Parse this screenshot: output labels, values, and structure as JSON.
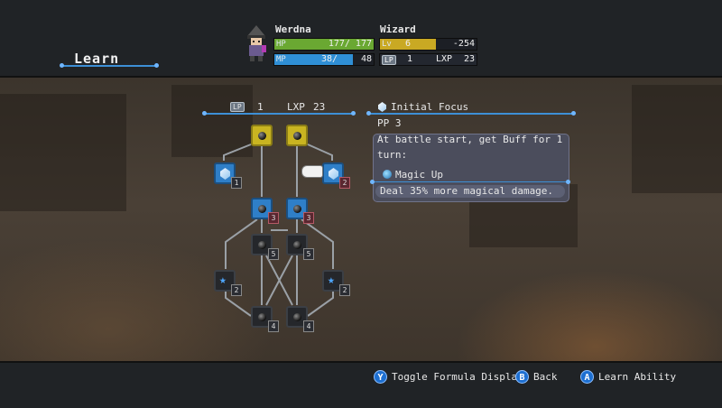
{
  "screen_title": "Learn",
  "character": {
    "name": "Werdna",
    "class": "Wizard",
    "hp": {
      "label": "HP",
      "current": "177",
      "max": "177",
      "text": "177/ 177",
      "fraction": 1.0
    },
    "mp": {
      "label": "MP",
      "current": "38",
      "max": "48",
      "text": "38/",
      "max_text": "48",
      "fraction": 0.79
    },
    "lv": {
      "label": "Lv",
      "value": "6",
      "exp_text": "-254",
      "fraction": 0.6
    },
    "lp_header": {
      "label": "LP",
      "value": "1",
      "lxp_label": "LXP",
      "lxp_value": "23"
    }
  },
  "tree_header": {
    "lp_label": "LP",
    "lp_value": "1",
    "lxp_label": "LXP",
    "lxp_value": "23"
  },
  "ability": {
    "name": "Initial Focus",
    "pp": "PP 3",
    "description_line1": "At battle start, get Buff for 1",
    "description_line2": "turn:",
    "buff_name": "Magic Up",
    "effect": "Deal 35% more magical damage."
  },
  "tree_nodes": {
    "n_left_gem": "1",
    "n_right_gem": "2",
    "n_left_mid": "3",
    "n_right_mid": "3",
    "n_left_dark": "5",
    "n_right_dark": "5",
    "n_left_star": "2",
    "n_right_star": "2",
    "n_left_bottom": "4",
    "n_right_bottom": "4"
  },
  "footer": {
    "y_icon": "Y",
    "y_label": "Toggle Formula Display",
    "b_icon": "B",
    "b_label": "Back",
    "a_icon": "A",
    "a_label": "Learn Ability"
  },
  "colors": {
    "hp": "#6aa832",
    "mp": "#2f8fd6",
    "lv": "#c9a923",
    "accent": "#3d8fd6"
  }
}
